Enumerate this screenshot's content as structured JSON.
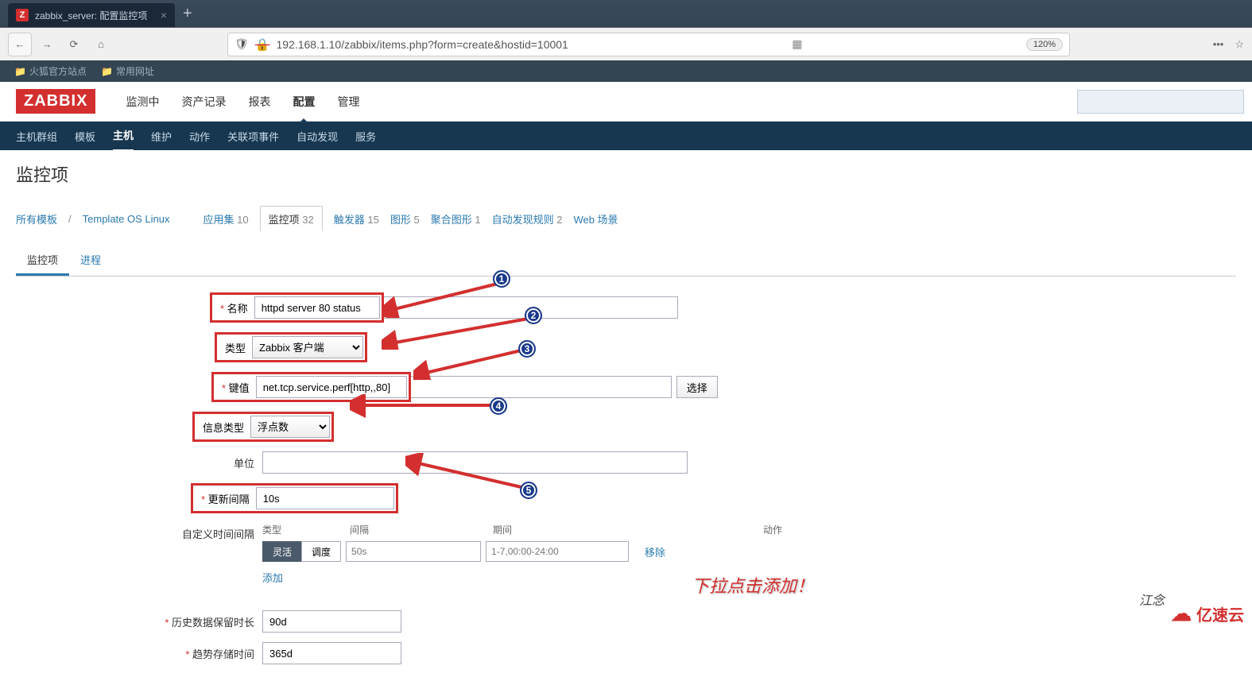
{
  "browser": {
    "tab_title": "zabbix_server: 配置监控项",
    "tab_favicon": "Z",
    "url": "192.168.1.10/zabbix/items.php?form=create&hostid=10001",
    "zoom": "120%",
    "bookmarks": [
      "火狐官方站点",
      "常用网址"
    ]
  },
  "zabbix": {
    "logo": "ZABBIX",
    "main_nav": [
      "监测中",
      "资产记录",
      "报表",
      "配置",
      "管理"
    ],
    "main_nav_active": "配置",
    "sub_nav": [
      "主机群组",
      "模板",
      "主机",
      "维护",
      "动作",
      "关联项事件",
      "自动发现",
      "服务"
    ],
    "sub_nav_active": "主机"
  },
  "page": {
    "title": "监控项",
    "breadcrumb": {
      "all_templates": "所有模板",
      "template_name": "Template OS Linux"
    },
    "filters": [
      {
        "label": "应用集",
        "count": "10"
      },
      {
        "label": "监控项",
        "count": "32",
        "active": true
      },
      {
        "label": "触发器",
        "count": "15"
      },
      {
        "label": "图形",
        "count": "5"
      },
      {
        "label": "聚合图形",
        "count": "1"
      },
      {
        "label": "自动发现规则",
        "count": "2"
      },
      {
        "label": "Web 场景",
        "count": ""
      }
    ],
    "form_tabs": [
      "监控项",
      "进程"
    ],
    "form_tab_active": "监控项"
  },
  "form": {
    "name_label": "名称",
    "name_value": "httpd server 80 status",
    "type_label": "类型",
    "type_value": "Zabbix 客户端",
    "key_label": "键值",
    "key_value": "net.tcp.service.perf[http,,80]",
    "key_select_btn": "选择",
    "info_type_label": "信息类型",
    "info_type_value": "浮点数",
    "unit_label": "单位",
    "unit_value": "",
    "update_interval_label": "更新间隔",
    "update_interval_value": "10s",
    "custom_interval_label": "自定义时间间隔",
    "interval_headers": {
      "type": "类型",
      "interval": "间隔",
      "period": "期间",
      "action": "动作"
    },
    "seg_flex": "灵活",
    "seg_sched": "调度",
    "int_placeholder": "50s",
    "period_placeholder": "1-7,00:00-24:00",
    "remove": "移除",
    "add": "添加",
    "history_label": "历史数据保留时长",
    "history_value": "90d",
    "trend_label": "趋势存储时间",
    "trend_value": "365d"
  },
  "annotations": {
    "numbers": [
      "1",
      "2",
      "3",
      "4",
      "5"
    ],
    "note_red": "下拉点击添加！",
    "signature": "江念",
    "corner": "亿速云"
  }
}
